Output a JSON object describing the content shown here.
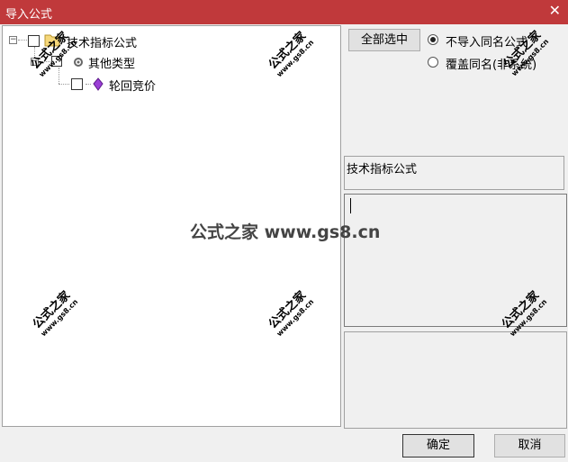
{
  "window": {
    "title": "导入公式",
    "close_glyph": "✕"
  },
  "tree": {
    "root": {
      "label": "技术指标公式",
      "expander": "−"
    },
    "child": {
      "label": "其他类型",
      "expander": "−"
    },
    "leaf": {
      "label": "轮回竞价"
    }
  },
  "options": {
    "select_all_label": "全部选中",
    "radio_skip_label": "不导入同名公式",
    "radio_overwrite_label": "覆盖同名(非系统)",
    "selected_radio": "skip"
  },
  "info": {
    "category_text": "技术指标公式"
  },
  "footer": {
    "ok_label": "确定",
    "cancel_label": "取消"
  },
  "watermark": {
    "center_text": "公式之家 www.gs8.cn",
    "stamp_cn": "公式之家",
    "stamp_url": "www.gs8.cn"
  }
}
